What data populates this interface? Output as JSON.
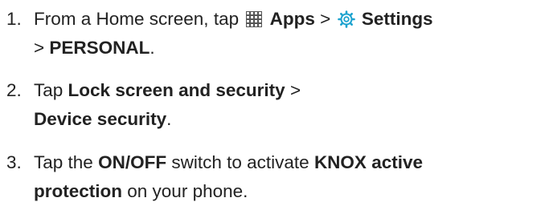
{
  "steps": [
    {
      "number": "1.",
      "line1_text_a": "From a Home screen, tap",
      "apps_icon": "apps-grid-icon",
      "apps_label": "Apps",
      "sep1": ">",
      "settings_icon": "settings-gear-icon",
      "settings_label": "Settings",
      "line2_sep": ">",
      "personal_label": "PERSONAL",
      "line2_end": "."
    },
    {
      "number": "2.",
      "line1_text_a": "Tap",
      "lock_label": "Lock screen and security",
      "sep": ">",
      "device_security_label": "Device security",
      "line2_end": "."
    },
    {
      "number": "3.",
      "line1_text_a": "Tap the",
      "onoff_label": "ON/OFF",
      "line1_text_b": "switch to activate",
      "knox_label_1": "KNOX active",
      "knox_label_2": "protection",
      "line2_text": "on your phone."
    }
  ],
  "colors": {
    "text": "#222222",
    "settings_icon": "#1ea3cf",
    "apps_icon": "#555555"
  }
}
